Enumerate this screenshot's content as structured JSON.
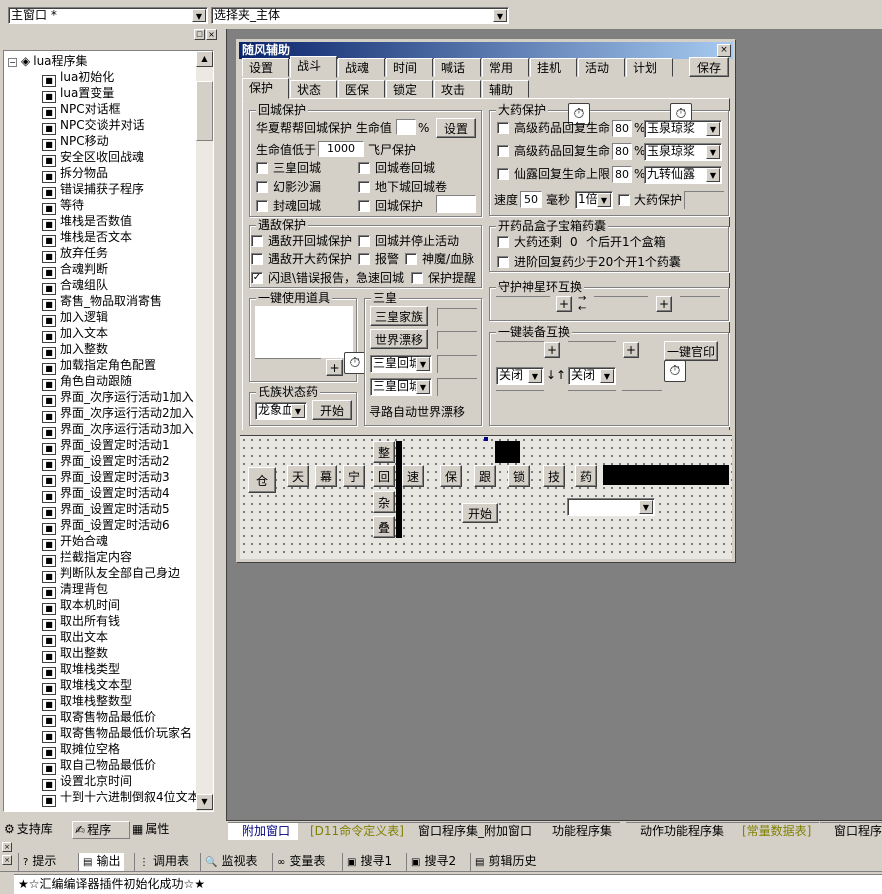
{
  "top": {
    "window_select": "主窗口 *",
    "folder_select": "选择夹_主体"
  },
  "tree": {
    "root": "lua程序集",
    "items": [
      "lua初始化",
      "lua置变量",
      "NPC对话框",
      "NPC交谈并对话",
      "NPC移动",
      "安全区收回战魂",
      "拆分物品",
      "错误捕获子程序",
      "等待",
      "堆栈是否数值",
      "堆栈是否文本",
      "放弃任务",
      "合魂判断",
      "合魂组队",
      "寄售_物品取消寄售",
      "加入逻辑",
      "加入文本",
      "加入整数",
      "加载指定角色配置",
      "角色自动跟随",
      "界面_次序运行活动1加入",
      "界面_次序运行活动2加入",
      "界面_次序运行活动3加入",
      "界面_设置定时活动1",
      "界面_设置定时活动2",
      "界面_设置定时活动3",
      "界面_设置定时活动4",
      "界面_设置定时活动5",
      "界面_设置定时活动6",
      "开始合魂",
      "拦截指定内容",
      "判断队友全部自己身边",
      "清理背包",
      "取本机时间",
      "取出所有钱",
      "取出文本",
      "取出整数",
      "取堆栈类型",
      "取堆栈文本型",
      "取堆栈整数型",
      "取寄售物品最低价",
      "取寄售物品最低价玩家名",
      "取摊位空格",
      "取自己物品最低价",
      "设置北京时间",
      "十到十六进制倒叙4位文本"
    ]
  },
  "left_tabs": [
    "支持库",
    "程序",
    "属性"
  ],
  "form": {
    "title": "随风辅助",
    "tabs_row1": [
      "设置",
      "战斗",
      "战魂",
      "时间",
      "喊话",
      "常用",
      "挂机",
      "活动",
      "计划"
    ],
    "save": "保存",
    "tabs_row2": [
      "保护",
      "状态",
      "医保",
      "锁定",
      "攻击",
      "辅助"
    ],
    "city": {
      "title": "回城保护",
      "label1": "华夏帮帮回城保护 生命值",
      "pct": "%",
      "set": "设置",
      "label2": "生命值低于",
      "hp_value": "1000",
      "label3": "飞尸保护",
      "checks": [
        "三皇回城",
        "回城卷回城",
        "幻影沙漏",
        "地下城回城卷",
        "封魂回城",
        "回城保护"
      ]
    },
    "enemy": {
      "title": "遇敌保护",
      "checks": [
        "遇敌开回城保护",
        "回城并停止活动",
        "遇敌开大药保护",
        "报警",
        "神魔/血脉",
        "闪退\\错误报告，急速回城",
        "保护提醒"
      ],
      "checked_index": 5
    },
    "items": {
      "title": "一键使用道具",
      "plus": "+"
    },
    "sanhuang": {
      "title": "三皇",
      "buttons": [
        "三皇家族",
        "世界漂移"
      ],
      "combos": [
        "三皇回城",
        "三皇回城"
      ],
      "route": "寻路自动世界漂移"
    },
    "clan": {
      "title": "氏族状态药",
      "combo": "龙象血",
      "start": "开始"
    },
    "potion": {
      "title": "大药保护",
      "rows": [
        {
          "label": "高级药品回复生命",
          "value": "80",
          "pct": "%",
          "item": "玉泉琼浆"
        },
        {
          "label": "高级药品回复生命",
          "value": "80",
          "pct": "%",
          "item": "玉泉琼浆"
        },
        {
          "label": "仙露回复生命上限",
          "value": "80",
          "pct": "%",
          "item": "九转仙露"
        }
      ],
      "speed_label": "速度",
      "speed": "50",
      "ms": "毫秒",
      "mult": "1倍",
      "big": "大药保护"
    },
    "box": {
      "title": "开药品盒子宝箱药囊",
      "row1a": "大药还剩",
      "row1v": "0",
      "row1b": "个后开1个盒箱",
      "row2": "进阶回复药少于20个开1个药囊"
    },
    "guard": {
      "title": "守护神星环互换",
      "plus": "+"
    },
    "equip": {
      "title": "一键装备互换",
      "plus": "+",
      "official": "一键官印",
      "off1": "关闭",
      "off2": "关闭"
    },
    "bottom": {
      "cang": "仓",
      "chars": [
        "天",
        "幕",
        "宁",
        "回",
        "速",
        "保",
        "跟",
        "锁",
        "技",
        "药"
      ],
      "vertical": [
        "整",
        "回",
        "杂",
        "叠"
      ],
      "start": "开始"
    }
  },
  "bottom_tabs": [
    "附加窗口",
    "[D11命令定义表]",
    "窗口程序集_附加窗口",
    "功能程序集",
    "动作功能程序集",
    "[常量数据表]",
    "窗口程序集"
  ],
  "output_tabs": [
    "提示",
    "输出",
    "调用表",
    "监视表",
    "变量表",
    "搜寻1",
    "搜寻2",
    "剪辑历史"
  ],
  "status": "★☆汇编编译器插件初始化成功☆★",
  "colors": {
    "title_bar": "#0a246a",
    "canvas": "#808080",
    "tab_blue": "#000080",
    "tab_olive": "#808000"
  }
}
